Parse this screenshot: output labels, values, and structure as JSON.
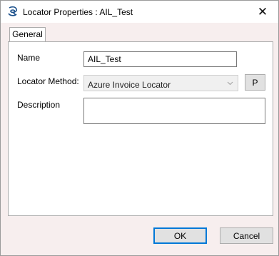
{
  "window": {
    "title": "Locator Properties : AIL_Test",
    "app_icon": "locator-icon",
    "close_glyph": "✕"
  },
  "tabs": [
    {
      "label": "General",
      "selected": true
    }
  ],
  "form": {
    "name_label": "Name",
    "name_value": "AIL_Test",
    "method_label": "Locator Method:",
    "method_value": "Azure Invoice Locator",
    "method_button_label": "P",
    "description_label": "Description",
    "description_value": ""
  },
  "footer": {
    "ok_label": "OK",
    "cancel_label": "Cancel"
  },
  "colors": {
    "dialog_background": "#f7eeee",
    "focus_accent": "#0078d7"
  }
}
